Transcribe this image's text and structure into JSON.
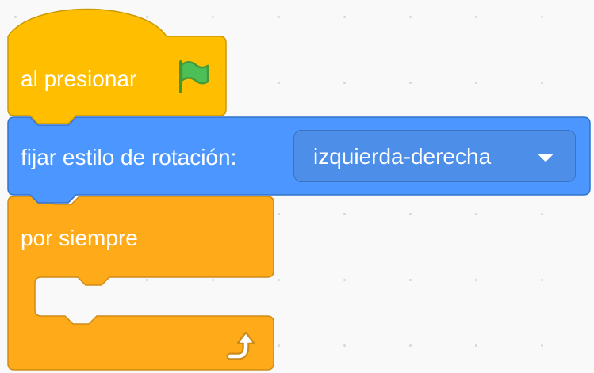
{
  "workspace": {
    "background": "#f9f9f9",
    "dot_color": "#d6d6d6"
  },
  "blocks": {
    "hat": {
      "label": "al presionar",
      "icon": "green-flag-icon",
      "color": "#ffbf00",
      "border": "#cc9900"
    },
    "set_rotation": {
      "label": "fijar estilo de rotación:",
      "dropdown_value": "izquierda-derecha",
      "dropdown_icon": "caret-down-icon",
      "color": "#4c97ff",
      "border": "#3373cc"
    },
    "forever": {
      "label": "por siempre",
      "icon": "repeat-arrow-icon",
      "color": "#ffab19",
      "border": "#cf8b17"
    }
  }
}
